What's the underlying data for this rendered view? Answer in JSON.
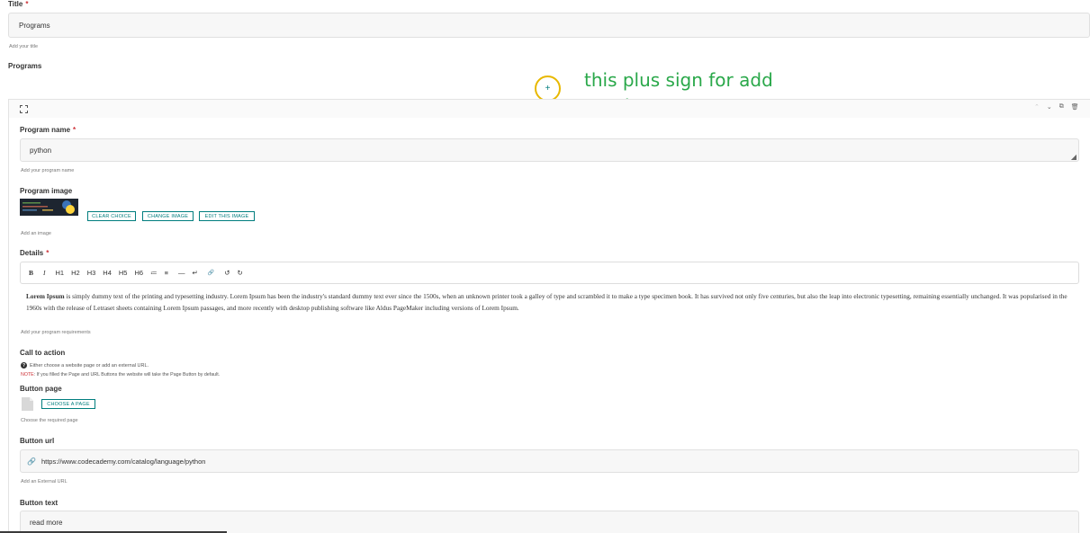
{
  "title_field": {
    "label": "Title",
    "required_mark": "*",
    "value": "Programs",
    "help": "Add your title"
  },
  "programs_label": "Programs",
  "annotation": {
    "plus_symbol": "+",
    "line1": "this plus sign for add",
    "line2": "another program",
    "color": "#2aa84a",
    "circle_color": "#e8b800"
  },
  "block": {
    "program_name": {
      "label": "Program name",
      "required_mark": "*",
      "value": "python",
      "help": "Add your program name"
    },
    "program_image": {
      "label": "Program image",
      "help": "Add an image",
      "buttons": {
        "clear": "CLEAR CHOICE",
        "change": "CHANGE IMAGE",
        "edit": "EDIT THIS IMAGE"
      }
    },
    "details": {
      "label": "Details",
      "required_mark": "*",
      "toolbar": [
        "B",
        "I",
        "H1",
        "H2",
        "H3",
        "H4",
        "H5",
        "H6",
        "≔",
        "≡",
        "—",
        "↵",
        "🔗",
        "↺",
        "↻"
      ],
      "bold_lead": "Lorem Ipsum",
      "body": " is simply dummy text of the printing and typesetting industry. Lorem Ipsum has been the industry's standard dummy text ever since the 1500s, when an unknown printer took a galley of type and scrambled it to make a type specimen book. It has survived not only five centuries, but also the leap into electronic typesetting, remaining essentially unchanged. It was popularised in the 1960s with the release of Letraset sheets containing Lorem Ipsum passages, and more recently with desktop publishing software like Aldus PageMaker including versions of Lorem Ipsum.",
      "help": "Add your program requirements"
    },
    "call_to_action": {
      "label": "Call to action",
      "info": "Either choose a website page or add an external URL.",
      "note_label": "NOTE",
      "note": ": If you filled the Page and URL Buttons the website will take the Page Button by default."
    },
    "button_page": {
      "label": "Button page",
      "button": "CHOOSE A PAGE",
      "help": "Choose the required page"
    },
    "button_url": {
      "label": "Button url",
      "value": "https://www.codecademy.com/catalog/language/python",
      "help": "Add an External URL"
    },
    "button_text": {
      "label": "Button text",
      "value": "read more"
    }
  }
}
